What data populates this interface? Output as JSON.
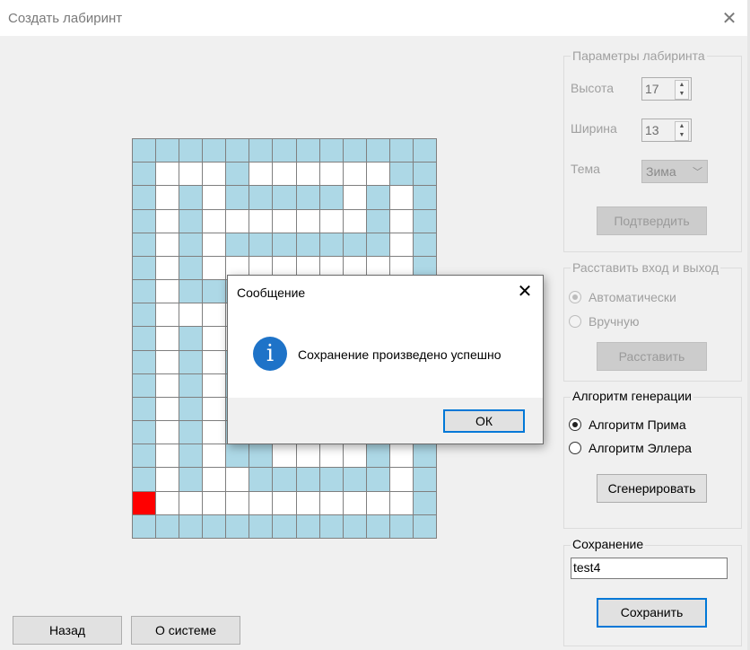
{
  "window": {
    "title": "Создать лабиринт",
    "close_glyph": "✕"
  },
  "maze": {
    "rows": 17,
    "cols": 13,
    "colors": {
      "wall": "#add8e6",
      "path": "#ffffff",
      "marker": "#ff0000"
    },
    "grid": [
      "WWWWWWWWWWWWW",
      "WPPPWPPPPPPWW",
      "WPWPWWWWWPWPW",
      "WPWPPPPPPPWPW",
      "WPWPWWWWWWWPW",
      "WPWPPPPPPPPPW",
      "WPWWWPWPWPWPW",
      "WPPPPPWPWPWPW",
      "WPWPPPWPWPWPW",
      "WPWPWPWPWPWPW",
      "WPWPWPWPWPWPW",
      "WPWPWPWPWPWPW",
      "WPWPWPWPWPWPW",
      "WPWPWWPPPPWPW",
      "WPWPPWWWWWWPW",
      "RPPPPPPPPPPPW",
      "WWWWWWWWWWWWW"
    ]
  },
  "params_group": {
    "title": "Параметры лабиринта",
    "height_label": "Высота",
    "height_value": "17",
    "width_label": "Ширина",
    "width_value": "13",
    "theme_label": "Тема",
    "theme_value": "Зима",
    "confirm_button": "Подтвердить"
  },
  "entry_group": {
    "title": "Расставить вход и выход",
    "auto_label": "Автоматически",
    "manual_label": "Вручную",
    "place_button": "Расставить"
  },
  "algo_group": {
    "title": "Алгоритм генерации",
    "prim_label": "Алгоритм Прима",
    "eller_label": "Алгоритм Эллера",
    "generate_button": "Сгенерировать"
  },
  "save_group": {
    "title": "Сохранение",
    "filename": "test4",
    "save_button": "Сохранить"
  },
  "bottom": {
    "back_button": "Назад",
    "about_button": "О системе"
  },
  "dialog": {
    "title": "Сообщение",
    "close_glyph": "✕",
    "info_glyph": "i",
    "message": "Сохранение произведено успешно",
    "ok_button": "ОК"
  },
  "icons": [
    "close-icon",
    "spinner-up-icon",
    "spinner-down-icon",
    "dropdown-chevron-icon",
    "info-icon"
  ]
}
